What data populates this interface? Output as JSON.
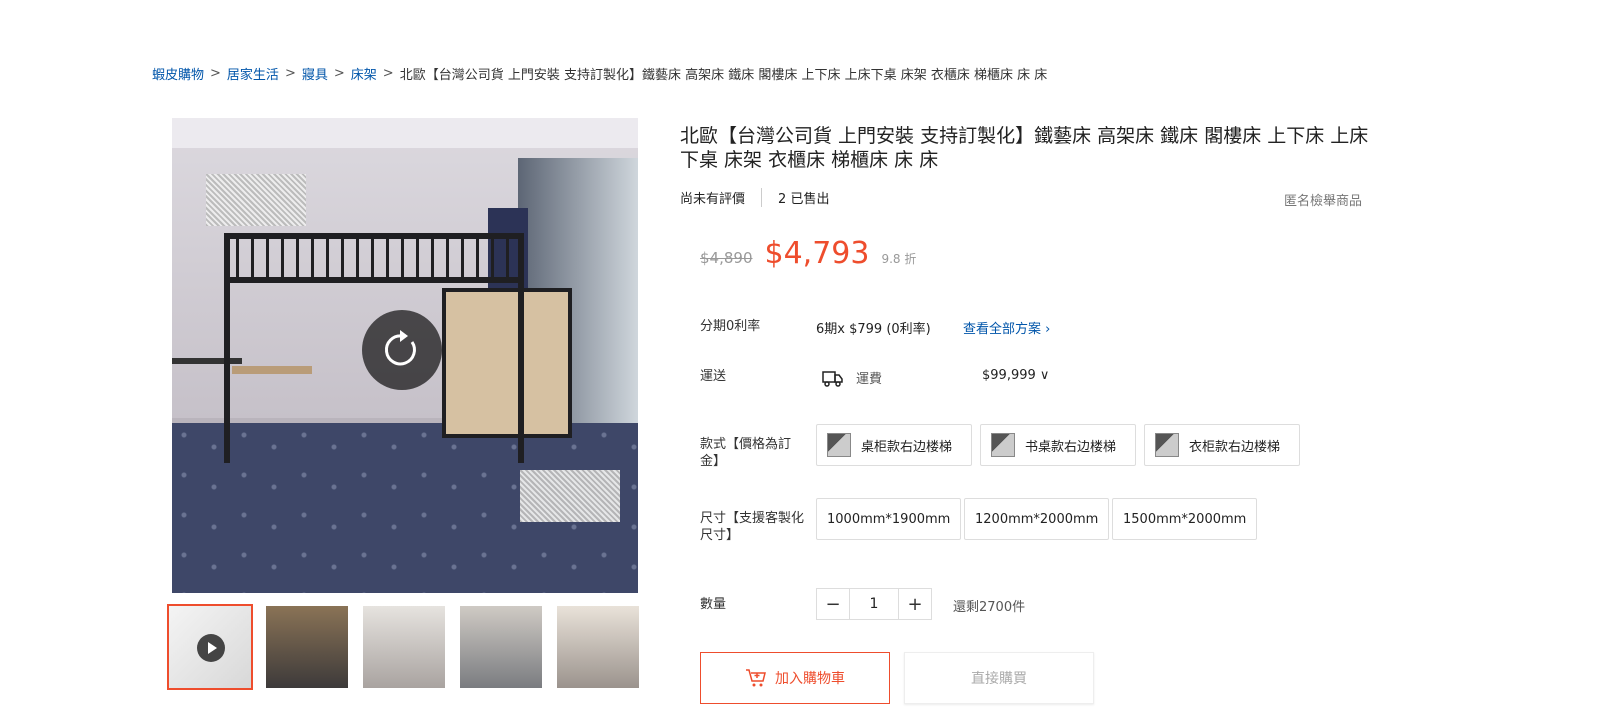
{
  "breadcrumb": {
    "items": [
      "蝦皮購物",
      "居家生活",
      "寢具",
      "床架"
    ],
    "separator": ">",
    "current": "北歐【台灣公司貨 上門安裝 支持訂製化】鐵藝床 高架床 鐵床 閣樓床 上下床 上床下桌 床架 衣櫃床 梯櫃床 床 床"
  },
  "product": {
    "title": "北歐【台灣公司貨 上門安裝 支持訂製化】鐵藝床 高架床 鐵床 閣樓床 上下床 上床下桌 床架 衣櫃床 梯櫃床 床 床",
    "rating_text": "尚未有評價",
    "sold_count": "2",
    "sold_label": "已售出",
    "report_label": "匿名檢舉商品",
    "original_price": "$4,890",
    "price": "$4,793",
    "discount": "9.8 折"
  },
  "installment": {
    "label": "分期0利率",
    "plan": "6期x $799 (0利率)",
    "link": "查看全部方案 ›"
  },
  "shipping": {
    "label": "運送",
    "fee_label": "運費",
    "fee": "$99,999 ∨",
    "icon": "truck-icon"
  },
  "variation_style": {
    "label": "款式【價格為訂金】",
    "options": [
      "桌柜款右边楼梯",
      "书桌款右边楼梯",
      "衣柜款右边楼梯"
    ]
  },
  "variation_size": {
    "label": "尺寸【支援客製化尺寸】",
    "options": [
      "1000mm*1900mm",
      "1200mm*2000mm",
      "1500mm*2000mm"
    ]
  },
  "quantity": {
    "label": "數量",
    "value": "1",
    "minus": "−",
    "plus": "+",
    "stock": "還剩2700件"
  },
  "actions": {
    "add_to_cart": "加入購物車",
    "buy_now": "直接購買"
  },
  "colors": {
    "accent": "#ee4d2d",
    "link": "#0055aa"
  }
}
